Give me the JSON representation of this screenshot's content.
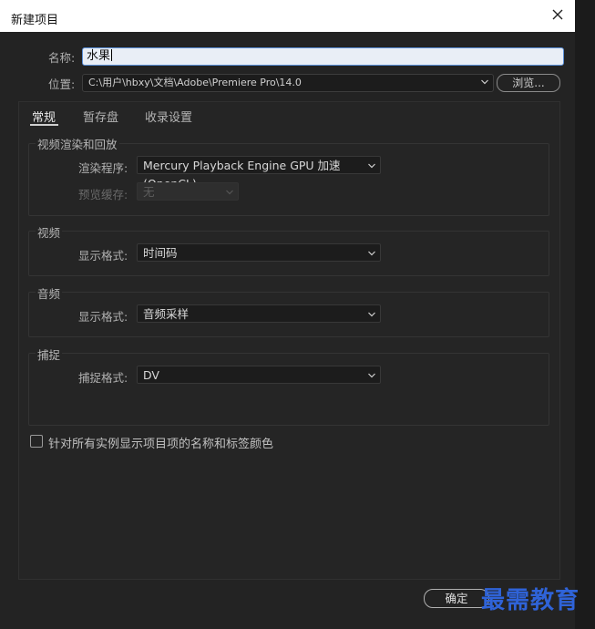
{
  "window": {
    "title": "新建项目"
  },
  "form": {
    "name_label": "名称:",
    "name_value": "水果",
    "location_label": "位置:",
    "location_value": "C:\\用户\\hbxy\\文档\\Adobe\\Premiere Pro\\14.0",
    "browse_label": "浏览..."
  },
  "tabs": [
    {
      "label": "常规",
      "active": true
    },
    {
      "label": "暂存盘",
      "active": false
    },
    {
      "label": "收录设置",
      "active": false
    }
  ],
  "render_group": {
    "title": "视频渲染和回放",
    "renderer_label": "渲染程序:",
    "renderer_value": "Mercury Playback Engine GPU 加速 (OpenCL)",
    "preview_cache_label": "预览缓存:",
    "preview_cache_value": "无"
  },
  "video_group": {
    "title": "视频",
    "format_label": "显示格式:",
    "format_value": "时间码"
  },
  "audio_group": {
    "title": "音频",
    "format_label": "显示格式:",
    "format_value": "音频采样"
  },
  "capture_group": {
    "title": "捕捉",
    "format_label": "捕捉格式:",
    "format_value": "DV"
  },
  "checkbox": {
    "label": "针对所有实例显示项目项的名称和标签颜色",
    "checked": false
  },
  "footer": {
    "ok_label": "确定"
  },
  "watermark": {
    "text": "最需教育"
  }
}
